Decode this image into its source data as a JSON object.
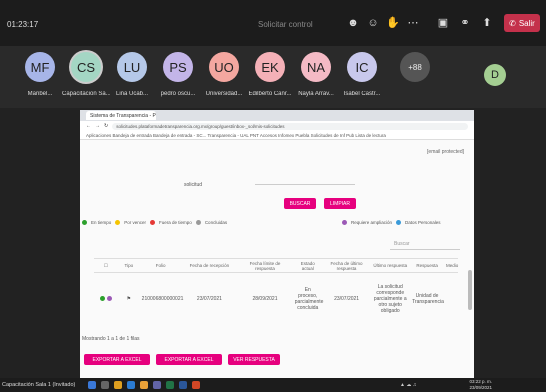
{
  "teams": {
    "timer": "01:23:17",
    "special_request": "Solicitar control",
    "leave_label": "Salir",
    "leave_color": "#c4314b",
    "icons": [
      "people-icon",
      "reactions-icon",
      "raise-hand-icon",
      "more-icon",
      "camera-off-icon",
      "mic-off-icon",
      "share-icon"
    ]
  },
  "participants": [
    {
      "initials": "MF",
      "name": "Maribel...",
      "color": "#a7b5e8"
    },
    {
      "initials": "CS",
      "name": "Capacitacion Sa...",
      "color": "#a4d6c4",
      "active": true
    },
    {
      "initials": "LU",
      "name": "Lina Ucab...",
      "color": "#b5c8e8"
    },
    {
      "initials": "PS",
      "name": "pedro oscu...",
      "color": "#c3b5e8"
    },
    {
      "initials": "UO",
      "name": "Universidad...",
      "color": "#f4a7a0"
    },
    {
      "initials": "EK",
      "name": "Edilberto Canr...",
      "color": "#f4b0b7"
    },
    {
      "initials": "NA",
      "name": "Nayla Arrav...",
      "color": "#f4bac5"
    },
    {
      "initials": "IC",
      "name": "Isabel Castr...",
      "color": "#c8c8ec"
    }
  ],
  "more_participants": "+88",
  "extra_avatar": "D",
  "browser": {
    "tab_title": "Sistema de Transparencia - PNT",
    "url": "solicitudes.plataformadetransparencia.org.mx/group/guest/inbox-_sol/mis-solicitudes",
    "bookmarks": "Aplicaciones  Bandeja de entrada  Bandeja de entrada - SC...  Transparencia - UAL  PNT Accesos  Infomex Puebla  Solicitudes de Inf Pub  Lista de lectura"
  },
  "page": {
    "email": "[email protected]",
    "solicitud_label": "solicitud",
    "search_btn": "BUSCAR",
    "clear_btn": "LIMPIAR",
    "legend_left": [
      "En tiempo",
      "Por vencer",
      "Fuera de tiempo",
      "Concluidas"
    ],
    "legend_left_colors": [
      "#2ca02c",
      "#f5c400",
      "#e53935",
      "#999999"
    ],
    "legend_right": [
      "Requiere ampliación",
      "Datos Personales"
    ],
    "legend_right_colors": [
      "#9b59b6",
      "#3a9ad9"
    ],
    "search_placeholder": "Buscar",
    "columns": [
      "Tipo",
      "Folio",
      "Fecha de recepción",
      "Fecha límite de respuesta",
      "Estado actual",
      "Fecha de último respuesta",
      "Último respuesta",
      "Respuesta",
      "Medio"
    ],
    "row": {
      "folio": "210006800000021",
      "fecha_recepcion": "23/07/2021",
      "fecha_limite": "28/09/2021",
      "estado": "En proceso, parcialmente concluida",
      "fecha_ultima": "23/07/2021",
      "ultima_respuesta": "La solicitud corresponde parcialmente a otro sujeto obligado",
      "respuesta": "Unidad de Transparencia"
    },
    "footer": "Mostrando 1 a 1 de 1 filas",
    "export_excel": "EXPORTAR A EXCEL",
    "export_pdf": "EXPORTAR A EXCEL",
    "export_respuesta": "VER RESPUESTA"
  },
  "taskbar": {
    "presenter": "Capacitación Sala 1 (Invitado)",
    "time": "03:22 p. m.",
    "date": "23/09/2021"
  }
}
